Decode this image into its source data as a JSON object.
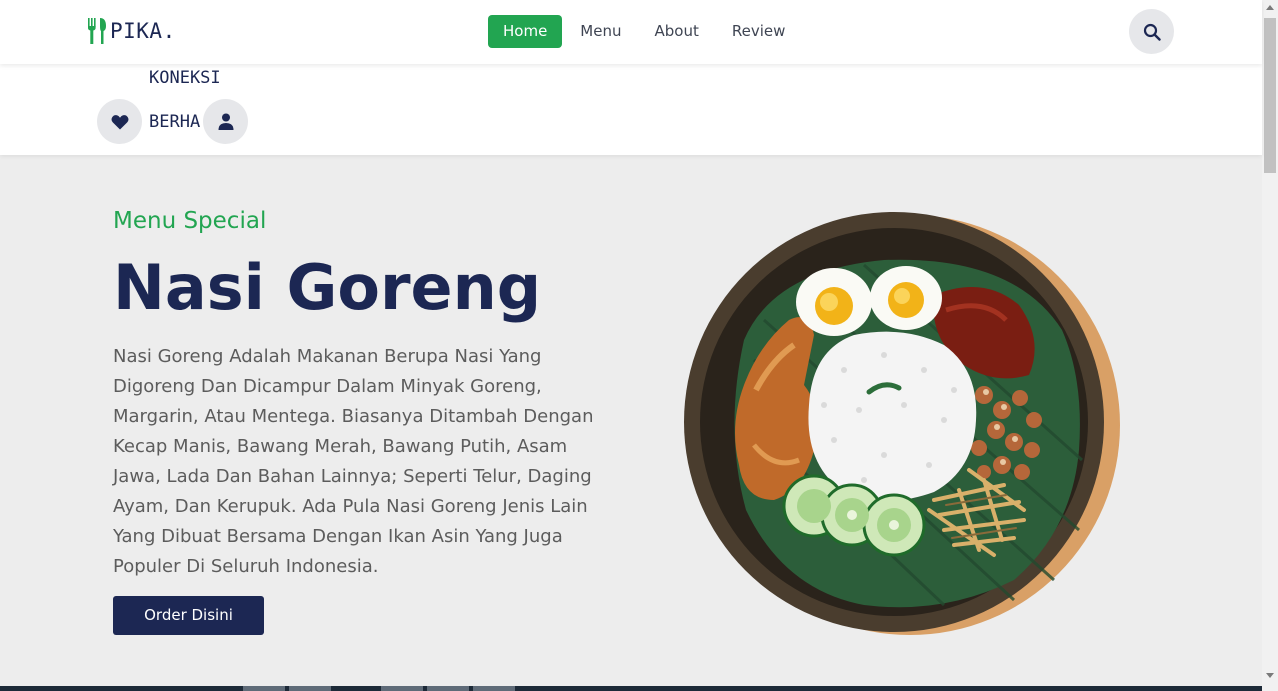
{
  "brand": {
    "name": "PIKA.",
    "logo_icon": "fork-spoon-icon",
    "accent_color": "#22a551"
  },
  "nav": {
    "items": [
      {
        "label": "Home",
        "active": true
      },
      {
        "label": "Menu",
        "active": false
      },
      {
        "label": "About",
        "active": false
      },
      {
        "label": "Review",
        "active": false
      }
    ]
  },
  "header": {
    "search_icon": "search-icon"
  },
  "subbar": {
    "connection_text_1": "KONEKSI",
    "connection_text_2": "BERHA",
    "heart_icon": "heart-icon",
    "user_icon": "user-icon"
  },
  "hero": {
    "label": "Menu Special",
    "title": "Nasi Goreng",
    "description": "Nasi Goreng Adalah Makanan Berupa Nasi Yang Digoreng Dan Dicampur Dalam Minyak Goreng, Margarin, Atau Mentega. Biasanya Ditambah Dengan Kecap Manis, Bawang Merah, Bawang Putih, Asam Jawa, Lada Dan Bahan Lainnya; Seperti Telur, Daging Ayam, Dan Kerupuk. Ada Pula Nasi Goreng Jenis Lain Yang Dibuat Bersama Dengan Ikan Asin Yang Juga Populer Di Seluruh Indonesia.",
    "order_button": "Order Disini"
  },
  "colors": {
    "primary": "#1c2753",
    "accent": "#22a551",
    "background": "#ededed"
  }
}
